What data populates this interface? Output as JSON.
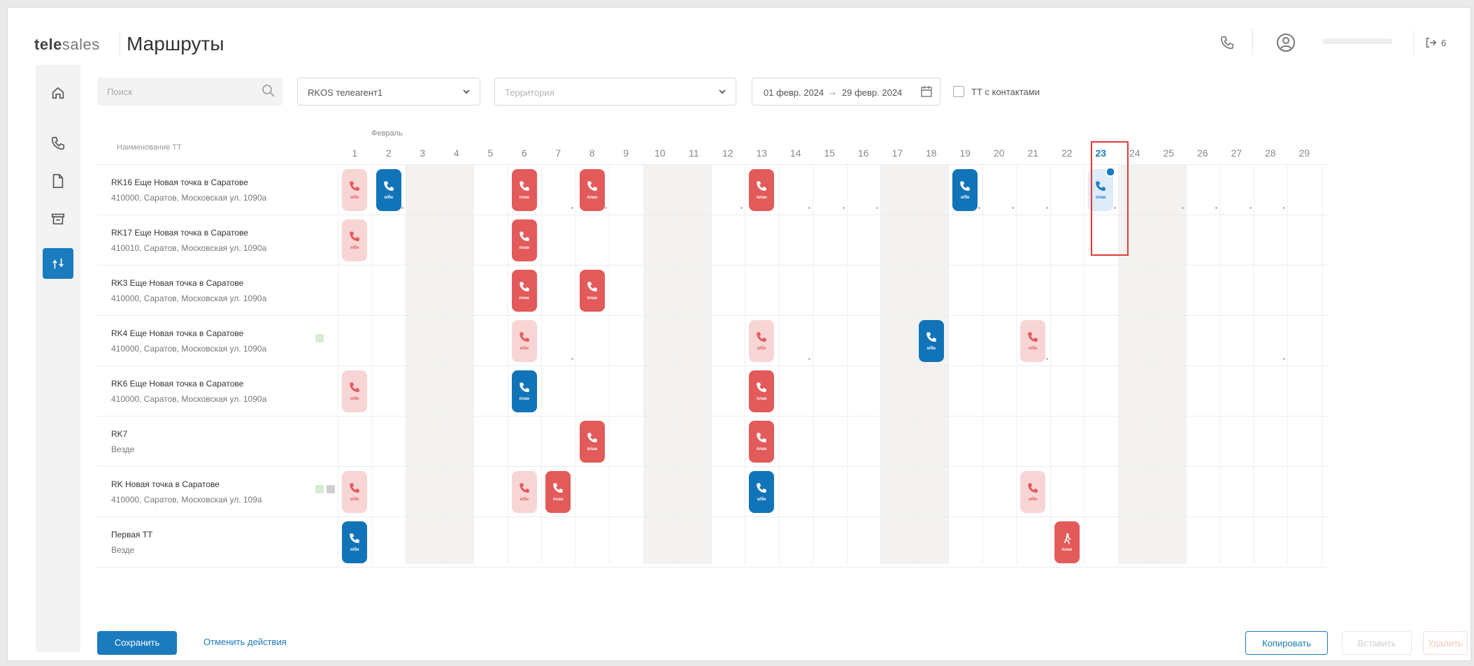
{
  "app": {
    "brand_bold": "tele",
    "brand_rest": "sales",
    "page_title": "Маршруты"
  },
  "header": {
    "logout_label": "6"
  },
  "sidebar": {
    "items": [
      "home-icon",
      "phone-icon",
      "document-icon",
      "store-icon",
      "routes-icon"
    ],
    "active": "routes-icon"
  },
  "filters": {
    "search_placeholder": "Поиск",
    "agent_select": "RKOS телеагент1",
    "territory_placeholder": "Территория",
    "date_from": "01 февр. 2024",
    "date_sep": "→",
    "date_to": "29 февр. 2024",
    "contacts_checkbox_label": "ТТ с контактами",
    "contacts_checked": false
  },
  "grid": {
    "name_header": "Наименование ТТ",
    "month": "Февраль",
    "days": [
      "1",
      "2",
      "3",
      "4",
      "5",
      "6",
      "7",
      "8",
      "9",
      "10",
      "11",
      "12",
      "13",
      "14",
      "15",
      "16",
      "17",
      "18",
      "19",
      "20",
      "21",
      "22",
      "23",
      "24",
      "25",
      "26",
      "27",
      "28",
      "29"
    ],
    "today": 23,
    "weekends": [
      [
        3,
        4
      ],
      [
        10,
        11
      ],
      [
        17,
        18
      ],
      [
        24,
        25
      ]
    ],
    "rows": [
      {
        "name": "RK16 Еще Новая точка в Саратове",
        "address": "410000, Саратов, Московская ул. 1090а",
        "icons": [],
        "events": [
          {
            "day": 1,
            "style": "pink",
            "type": "phone",
            "label": "н/бн"
          },
          {
            "day": 2,
            "style": "blue",
            "type": "phone",
            "label": "н/бн"
          },
          {
            "day": 6,
            "style": "red",
            "type": "phone",
            "label": "план"
          },
          {
            "day": 8,
            "style": "red",
            "type": "phone",
            "label": "план"
          },
          {
            "day": 13,
            "style": "red",
            "type": "phone",
            "label": "план"
          },
          {
            "day": 19,
            "style": "blue",
            "type": "phone",
            "label": "н/бн"
          },
          {
            "day": 23,
            "style": "light",
            "type": "phone",
            "label": "план",
            "badge": true
          }
        ],
        "dots": [
          2,
          7,
          8,
          12,
          14,
          15,
          16,
          19,
          20,
          21,
          23,
          25,
          26,
          27,
          28
        ]
      },
      {
        "name": "RK17 Еще Новая точка в Саратове",
        "address": "410010, Саратов, Московская ул. 1090а",
        "icons": [],
        "events": [
          {
            "day": 1,
            "style": "pink",
            "type": "phone",
            "label": "н/бн"
          },
          {
            "day": 6,
            "style": "red",
            "type": "phone",
            "label": "план"
          }
        ],
        "dots": []
      },
      {
        "name": "RK3 Еще Новая точка в Саратове",
        "address": "410000, Саратов, Московская ул. 1090а",
        "icons": [],
        "events": [
          {
            "day": 6,
            "style": "red",
            "type": "phone",
            "label": "план"
          },
          {
            "day": 8,
            "style": "red",
            "type": "phone",
            "label": "план"
          }
        ],
        "dots": []
      },
      {
        "name": "RK4 Еще Новая точка в Саратове",
        "address": "410000, Саратов, Московская ул. 1090а",
        "icons": [
          "contact-phone-icon"
        ],
        "events": [
          {
            "day": 6,
            "style": "pink",
            "type": "phone",
            "label": "н/бн"
          },
          {
            "day": 13,
            "style": "pink",
            "type": "phone",
            "label": "н/бн"
          },
          {
            "day": 18,
            "style": "blue",
            "type": "phone",
            "label": "н/бн"
          },
          {
            "day": 21,
            "style": "pink",
            "type": "phone",
            "label": "н/бн"
          }
        ],
        "dots": [
          7,
          14,
          21,
          28
        ]
      },
      {
        "name": "RK6 Еще Новая точка в Саратове",
        "address": "410000, Саратов, Московская ул. 1090а",
        "icons": [],
        "events": [
          {
            "day": 1,
            "style": "pink",
            "type": "phone",
            "label": "н/бн"
          },
          {
            "day": 6,
            "style": "blue",
            "type": "phone",
            "label": "план"
          },
          {
            "day": 13,
            "style": "red",
            "type": "phone",
            "label": "план"
          }
        ],
        "dots": []
      },
      {
        "name": "RK7",
        "address": "Везде",
        "icons": [],
        "events": [
          {
            "day": 8,
            "style": "red",
            "type": "phone",
            "label": "план"
          },
          {
            "day": 13,
            "style": "red",
            "type": "phone",
            "label": "план"
          }
        ],
        "dots": []
      },
      {
        "name": "RK Новая точка в Саратове",
        "address": "410000, Саратов, Московская ул. 109а",
        "icons": [
          "contact-phone-icon",
          "contact-person-icon"
        ],
        "events": [
          {
            "day": 1,
            "style": "pink",
            "type": "phone",
            "label": "н/бн"
          },
          {
            "day": 6,
            "style": "pink",
            "type": "phone",
            "label": "н/бн"
          },
          {
            "day": 7,
            "style": "red",
            "type": "phone",
            "label": "план"
          },
          {
            "day": 13,
            "style": "blue",
            "type": "phone",
            "label": "н/бн"
          },
          {
            "day": 21,
            "style": "pink",
            "type": "phone",
            "label": "н/бн"
          }
        ],
        "dots": []
      },
      {
        "name": "Первая ТТ",
        "address": "Везде",
        "icons": [],
        "events": [
          {
            "day": 1,
            "style": "blue",
            "type": "phone",
            "label": "н/бн"
          },
          {
            "day": 22,
            "style": "red",
            "type": "visit",
            "label": "план"
          }
        ],
        "dots": []
      }
    ]
  },
  "actions": {
    "save": "Сохранить",
    "cancel": "Отменить действия",
    "copy": "Копировать",
    "ghost1": "Вставить",
    "ghost2": "Удалить"
  },
  "colors": {
    "accent": "#1a7bbf",
    "event_red": "#e35a5a",
    "event_blue": "#1274b8",
    "event_pink": "#f8d5d5",
    "weekend": "#f4f2f0",
    "highlight": "#e53935"
  }
}
